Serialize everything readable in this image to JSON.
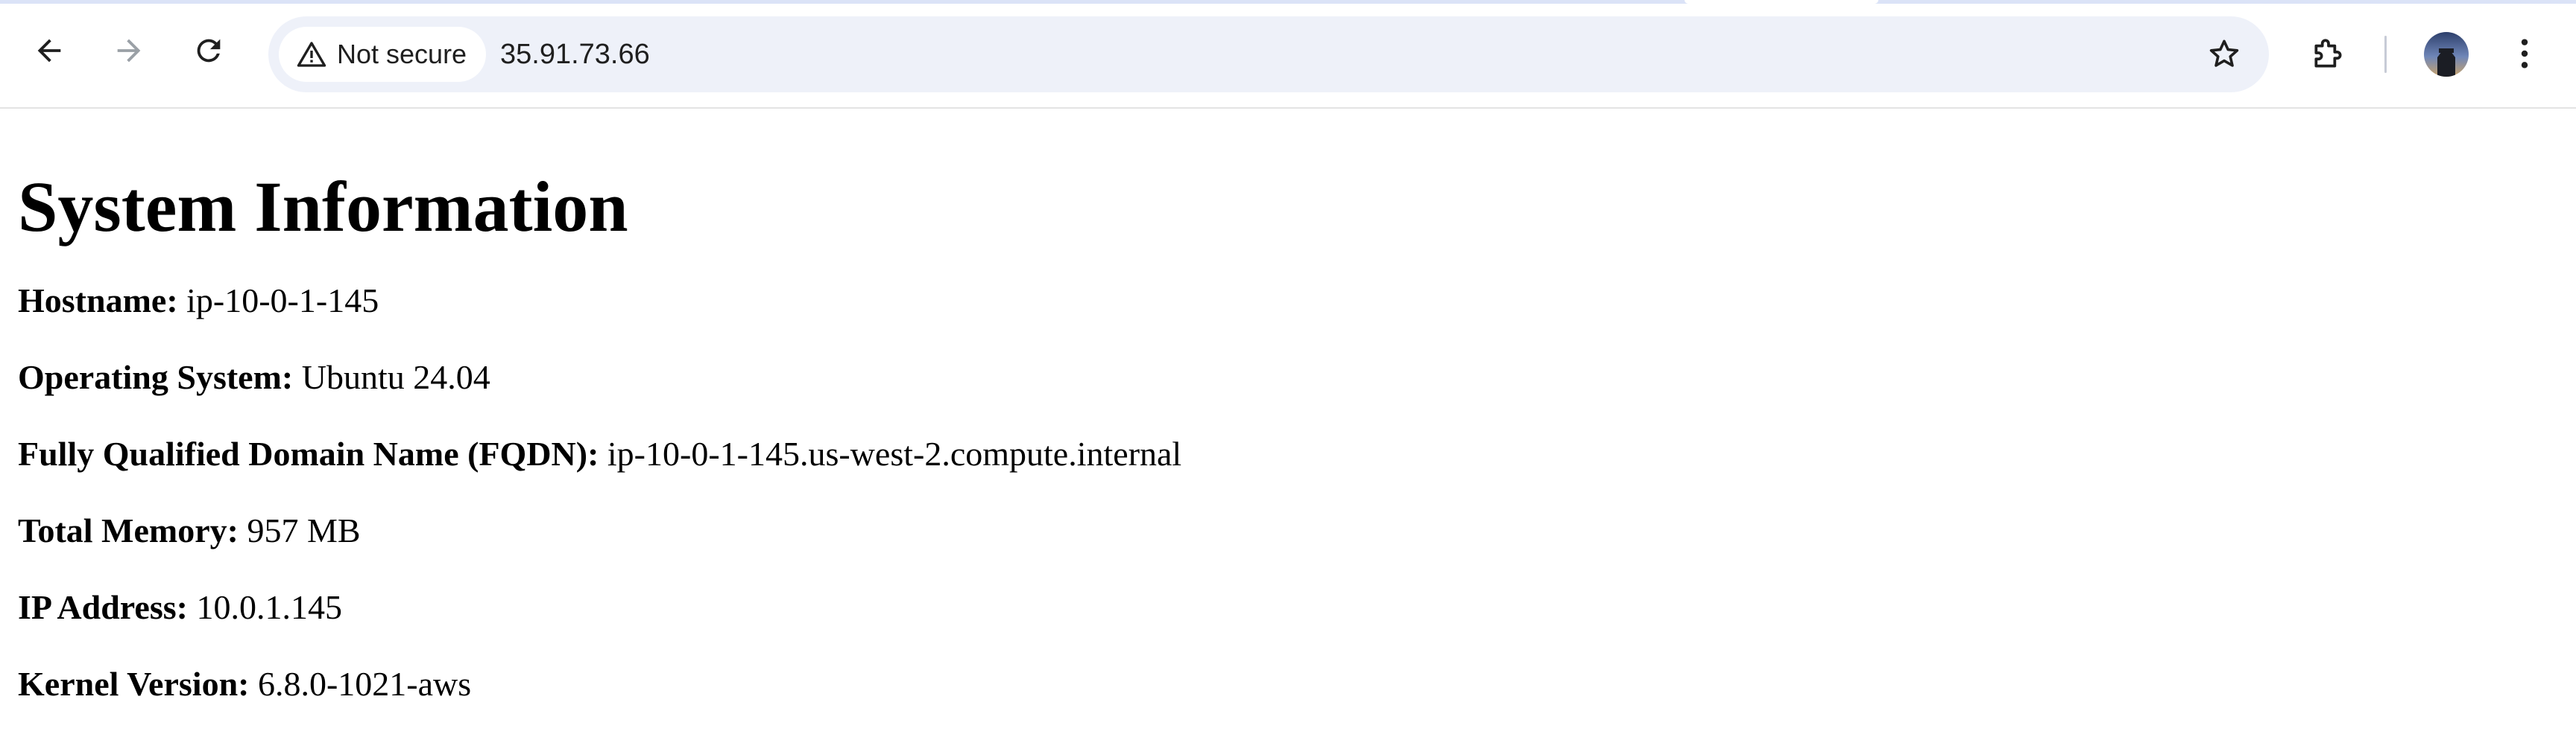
{
  "browser": {
    "address_bar": {
      "security_label": "Not secure",
      "url": "35.91.73.66"
    },
    "icons": {
      "back": "arrow-left-icon",
      "forward": "arrow-right-icon",
      "reload": "reload-icon",
      "security": "warning-triangle-icon",
      "bookmark": "star-icon",
      "extensions": "puzzle-piece-icon",
      "profile": "avatar",
      "menu": "kebab-menu-icon"
    },
    "forward_enabled": false
  },
  "page": {
    "title": "System Information",
    "rows": [
      {
        "key": "Hostname:",
        "value": "ip-10-0-1-145"
      },
      {
        "key": "Operating System:",
        "value": "Ubuntu 24.04"
      },
      {
        "key": "Fully Qualified Domain Name (FQDN):",
        "value": "ip-10-0-1-145.us-west-2.compute.internal"
      },
      {
        "key": "Total Memory:",
        "value": "957 MB"
      },
      {
        "key": "IP Address:",
        "value": "10.0.1.145"
      },
      {
        "key": "Kernel Version:",
        "value": "6.8.0-1021-aws"
      }
    ]
  },
  "colors": {
    "omnibox_background": "#eef1f9",
    "tab_strip": "#dbe3f7",
    "icon": "#1f1f1f",
    "icon_disabled": "#9aa0a6",
    "text": "#000000"
  }
}
